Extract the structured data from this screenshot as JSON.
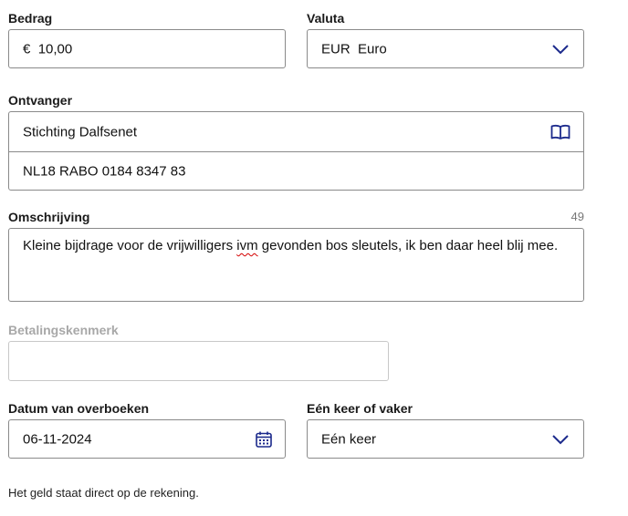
{
  "amount": {
    "label": "Bedrag",
    "currency_symbol": "€",
    "value": "10,00"
  },
  "currency": {
    "label": "Valuta",
    "code": "EUR",
    "name": "Euro"
  },
  "recipient": {
    "label": "Ontvanger",
    "name": "Stichting Dalfsenet",
    "iban": "NL18 RABO 0184 8347 83"
  },
  "description": {
    "label": "Omschrijving",
    "remaining_chars": "49",
    "text_before": "Kleine bijdrage voor de vrijwilligers ",
    "text_flagged": "ivm",
    "text_after": " gevonden bos sleutels, ik ben daar heel blij mee."
  },
  "payment_reference": {
    "label": "Betalingskenmerk",
    "value": ""
  },
  "transfer_date": {
    "label": "Datum van overboeken",
    "value": "06-11-2024"
  },
  "frequency": {
    "label": "Eén keer of vaker",
    "value": "Eén keer"
  },
  "info_note": "Het geld staat direct op de rekening.",
  "colors": {
    "accent": "#1c2a8c",
    "border": "#8a8a8a",
    "disabled": "#a8a8a8"
  }
}
